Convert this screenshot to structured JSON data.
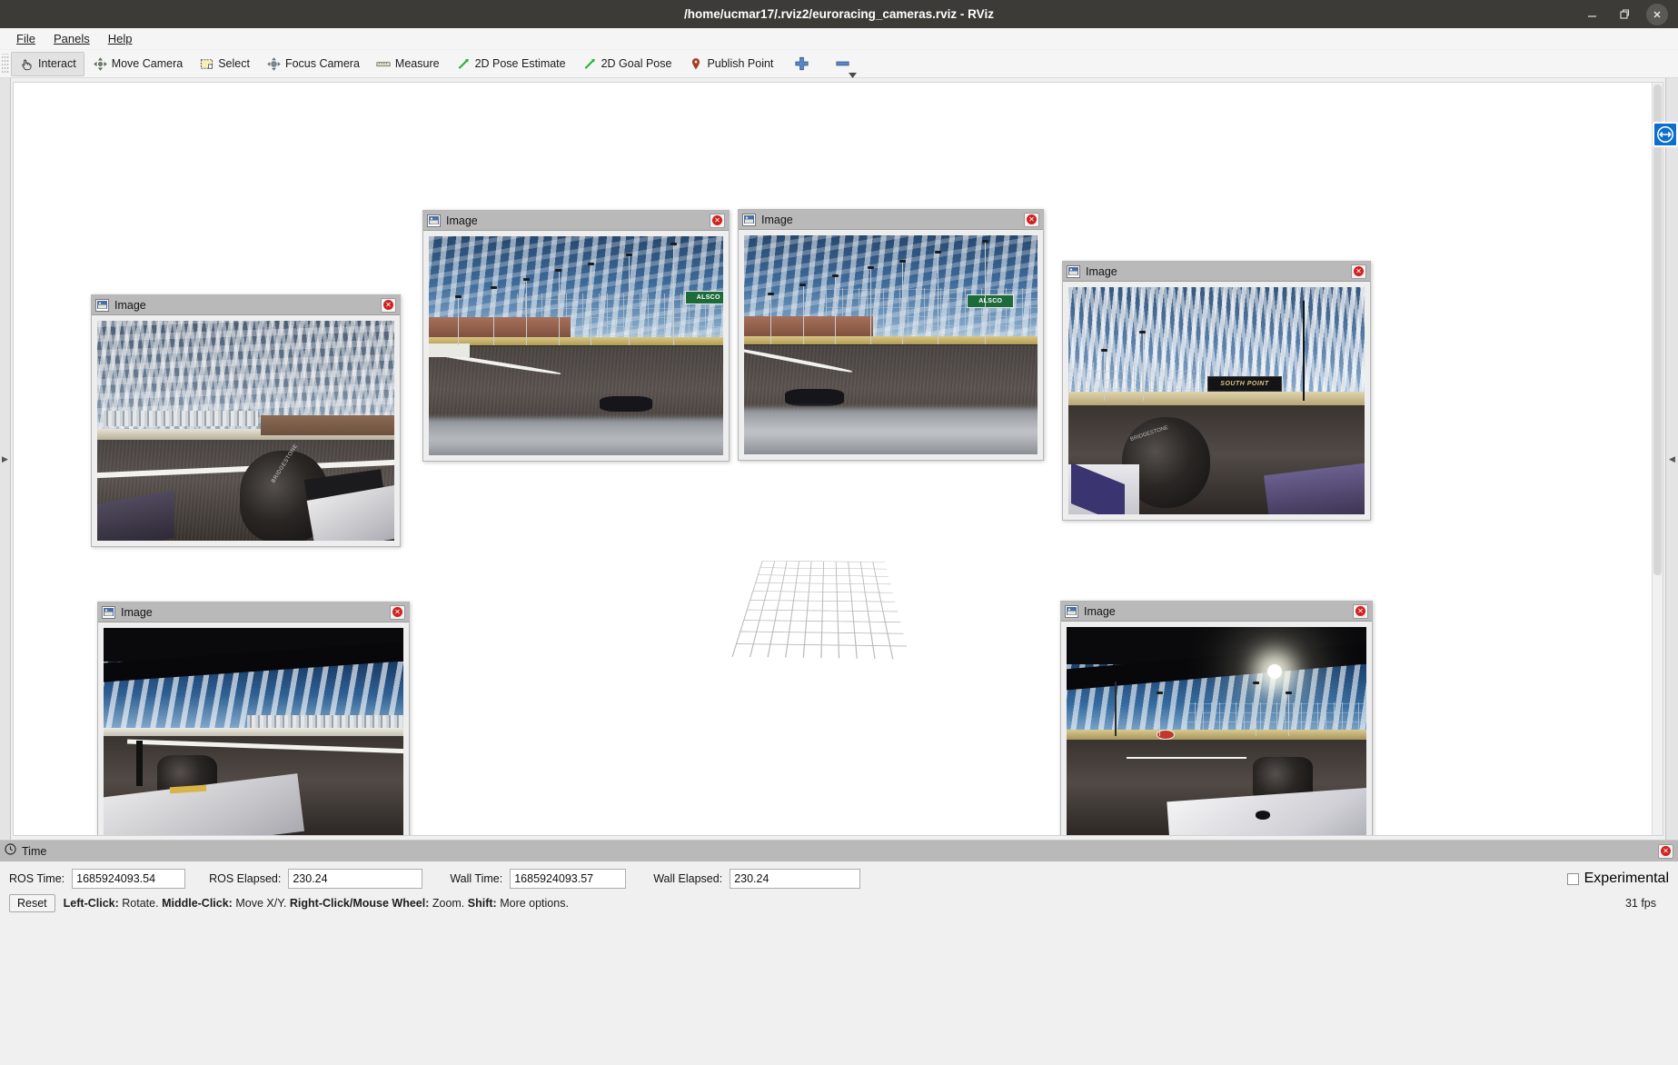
{
  "window": {
    "title": "/home/ucmar17/.rviz2/euroracing_cameras.rviz - RViz",
    "controls": {
      "minimize": "minimize-icon",
      "maximize": "restore-icon",
      "close": "close-icon"
    }
  },
  "menubar": {
    "items": [
      {
        "label": "File",
        "mnemonic": "F"
      },
      {
        "label": "Panels",
        "mnemonic": "P"
      },
      {
        "label": "Help",
        "mnemonic": "H"
      }
    ]
  },
  "toolbar": {
    "buttons": [
      {
        "label": "Interact",
        "icon": "hand-cursor-icon",
        "active": true
      },
      {
        "label": "Move Camera",
        "icon": "move-camera-icon",
        "active": false
      },
      {
        "label": "Select",
        "icon": "select-rect-icon",
        "active": false
      },
      {
        "label": "Focus Camera",
        "icon": "focus-camera-icon",
        "active": false
      },
      {
        "label": "Measure",
        "icon": "ruler-icon",
        "active": false
      },
      {
        "label": "2D Pose Estimate",
        "icon": "pose-arrow-icon",
        "active": false
      },
      {
        "label": "2D Goal Pose",
        "icon": "goal-arrow-icon",
        "active": false
      },
      {
        "label": "Publish Point",
        "icon": "map-pin-icon",
        "active": false
      }
    ],
    "add_tool_label": "+",
    "remove_tool_label": "-"
  },
  "viewport": {
    "grid": {
      "name": "grid-display",
      "cells": 10,
      "color": "#b4b4b4"
    },
    "panels": [
      {
        "id": "image-panel-left",
        "title": "Image",
        "icon": "image-display-icon",
        "close_icon": "close-icon",
        "scene": "track-left-front-wheel"
      },
      {
        "id": "image-panel-center-left",
        "title": "Image",
        "icon": "image-display-icon",
        "close_icon": "close-icon",
        "scene": "track-forward-catchfence",
        "sign_text": "ALSCO"
      },
      {
        "id": "image-panel-center-right",
        "title": "Image",
        "icon": "image-display-icon",
        "close_icon": "close-icon",
        "scene": "track-forward-catchfence-2",
        "sign_text": "ALSCO"
      },
      {
        "id": "image-panel-right",
        "title": "Image",
        "icon": "image-display-icon",
        "close_icon": "close-icon",
        "scene": "track-right-front-wheel",
        "sign_text": "SOUTH POINT"
      },
      {
        "id": "image-panel-bottom-left",
        "title": "Image",
        "icon": "image-display-icon",
        "close_icon": "close-icon",
        "scene": "track-left-side-grandstand"
      },
      {
        "id": "image-panel-bottom-right",
        "title": "Image",
        "icon": "image-display-icon",
        "close_icon": "close-icon",
        "scene": "track-right-side-sunflare"
      }
    ]
  },
  "edges": {
    "left_handle": "expand-left-panel-arrow",
    "right_handle": "collapse-right-panel-arrow",
    "remote_badge": "teamviewer-icon"
  },
  "time_panel": {
    "header": "Time",
    "header_icon": "clock-icon",
    "close_icon": "close-icon",
    "fields": [
      {
        "label": "ROS Time:",
        "value": "1685924093.54",
        "name": "ros-time-field"
      },
      {
        "label": "ROS Elapsed:",
        "value": "230.24",
        "name": "ros-elapsed-field"
      },
      {
        "label": "Wall Time:",
        "value": "1685924093.57",
        "name": "wall-time-field"
      },
      {
        "label": "Wall Elapsed:",
        "value": "230.24",
        "name": "wall-elapsed-field"
      }
    ],
    "experimental_label": "Experimental",
    "experimental_checked": false
  },
  "statusbar": {
    "reset_label": "Reset",
    "hint_left_click_key": "Left-Click:",
    "hint_left_click_val": "Rotate.",
    "hint_middle_click_key": "Middle-Click:",
    "hint_middle_click_val": "Move X/Y.",
    "hint_right_click_key": "Right-Click/Mouse Wheel:",
    "hint_right_click_val": "Zoom.",
    "hint_shift_key": "Shift:",
    "hint_shift_val": "More options.",
    "fps": "31 fps"
  },
  "colors": {
    "titlebar_bg": "#3c3b37",
    "panel_header_bg": "#b9b9b9",
    "close_red": "#cf2222",
    "accent_blue": "#0e6ecb",
    "viewport_bg": "#ffffff"
  }
}
